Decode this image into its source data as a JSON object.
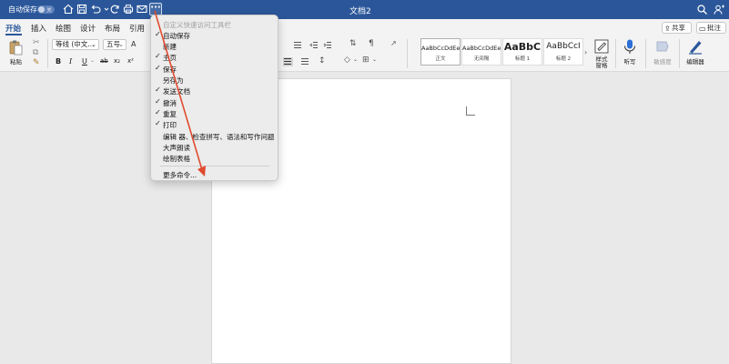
{
  "titlebar": {
    "autosave_label": "自动保存",
    "toggle_state": "关",
    "doc_title": "文档2",
    "more_label": "···",
    "bg_color": "#2b579a"
  },
  "qat_icons": [
    "home-icon",
    "save-icon",
    "undo-icon",
    "redo-icon",
    "print-icon",
    "send-icon"
  ],
  "tabs": {
    "items": [
      "开始",
      "插入",
      "绘图",
      "设计",
      "布局",
      "引用"
    ],
    "active": "开始",
    "share_label": "共享",
    "comment_label": "批注"
  },
  "ribbon": {
    "paste_label": "粘贴",
    "font_name": "等线 (中文...",
    "font_size": "五号",
    "format_buttons": [
      "B",
      "I",
      "U",
      "x₂",
      "x²"
    ],
    "styles": [
      {
        "sample": "AaBbCcDdEe",
        "name": "正文"
      },
      {
        "sample": "AaBbCcDdEe",
        "name": "无间隔"
      },
      {
        "sample": "AaBbC",
        "name": "标题 1"
      },
      {
        "sample": "AaBbCcI",
        "name": "标题 2"
      }
    ],
    "style_pane_label": "样式\n窗格",
    "dictate_label": "听写",
    "sensitivity_label": "敏感度",
    "editor_label": "编辑器"
  },
  "dropdown": {
    "header": "自定义快速访问工具栏",
    "items": [
      {
        "label": "自动保存",
        "checked": "✓"
      },
      {
        "label": "新建",
        "checked": ""
      },
      {
        "label": "主页",
        "checked": "✓"
      },
      {
        "label": "保存",
        "checked": "✓"
      },
      {
        "label": "另存为",
        "checked": ""
      },
      {
        "label": "发送文档",
        "checked": "✓"
      },
      {
        "label": "撤消",
        "checked": "✓"
      },
      {
        "label": "重复",
        "checked": "✓"
      },
      {
        "label": "打印",
        "checked": "✓"
      },
      {
        "label": "编辑 器、检查拼写、语法和写作问题",
        "checked": ""
      },
      {
        "label": "大声朗读",
        "checked": ""
      },
      {
        "label": "绘制表格",
        "checked": ""
      }
    ],
    "more_commands": "更多命令..."
  },
  "annotation_color": "#e04b2f"
}
